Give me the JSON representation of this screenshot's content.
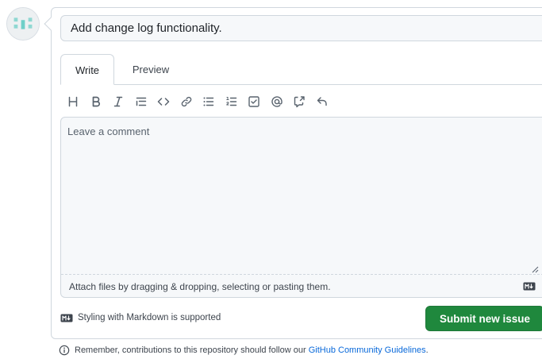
{
  "issue": {
    "title_value": "Add change log functionality.",
    "tabs": [
      {
        "label": "Write",
        "active": true
      },
      {
        "label": "Preview",
        "active": false
      }
    ],
    "toolbar": [
      {
        "icon": "heading-icon"
      },
      {
        "icon": "bold-icon"
      },
      {
        "icon": "italic-icon"
      },
      {
        "icon": "quote-icon"
      },
      {
        "icon": "code-icon"
      },
      {
        "icon": "link-icon"
      },
      {
        "icon": "unordered-list-icon"
      },
      {
        "icon": "ordered-list-icon"
      },
      {
        "icon": "task-list-icon"
      },
      {
        "icon": "mention-icon"
      },
      {
        "icon": "cross-reference-icon"
      },
      {
        "icon": "reply-icon"
      }
    ],
    "comment_placeholder": "Leave a comment",
    "attach_text": "Attach files by dragging & dropping, selecting or pasting them.",
    "markdown_note": "Styling with Markdown is supported",
    "submit_label": "Submit new issue"
  },
  "footer": {
    "text": "Remember, contributions to this repository should follow our",
    "link_text": "GitHub Community Guidelines",
    "end": "."
  },
  "colors": {
    "primary_button": "#1f883d",
    "link": "#0969da",
    "border": "#d0d7de",
    "field_bg": "#f6f8fa"
  }
}
